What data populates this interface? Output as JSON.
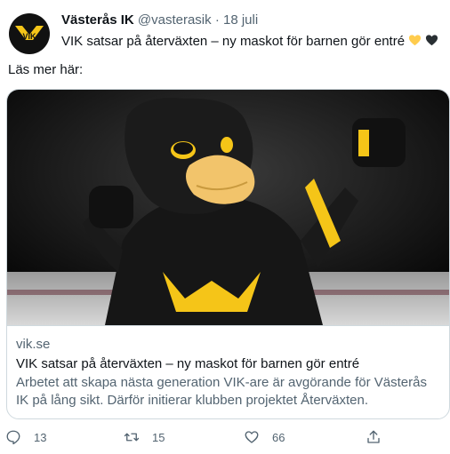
{
  "tweet": {
    "display_name": "Västerås IK",
    "handle": "@vasterasik",
    "separator": "·",
    "date": "18 juli",
    "text": "VIK satsar på återväxten – ny maskot för barnen gör entré",
    "emojis": [
      "yellow-heart",
      "black-heart"
    ],
    "secondary_text": "Läs mer här:"
  },
  "avatar": {
    "logo_text": "VIK",
    "logo_color": "#f5c518",
    "bg_color": "#111111"
  },
  "card": {
    "image_alt": "Eagle mascot in black and yellow VIK hockey jersey",
    "domain": "vik.se",
    "title": "VIK satsar på återväxten – ny maskot för barnen gör entré",
    "description": "Arbetet att skapa nästa generation VIK-are är avgörande för Västerås IK på lång sikt. Därför initierar klubben projektet Återväxten."
  },
  "actions": {
    "reply": {
      "icon": "reply-icon",
      "count": "13"
    },
    "retweet": {
      "icon": "retweet-icon",
      "count": "15"
    },
    "like": {
      "icon": "heart-icon",
      "count": "66"
    },
    "share": {
      "icon": "share-icon"
    }
  },
  "colors": {
    "text": "#0f1419",
    "muted": "#536471",
    "border": "#cfd9de",
    "brand_yellow": "#f5c518"
  }
}
